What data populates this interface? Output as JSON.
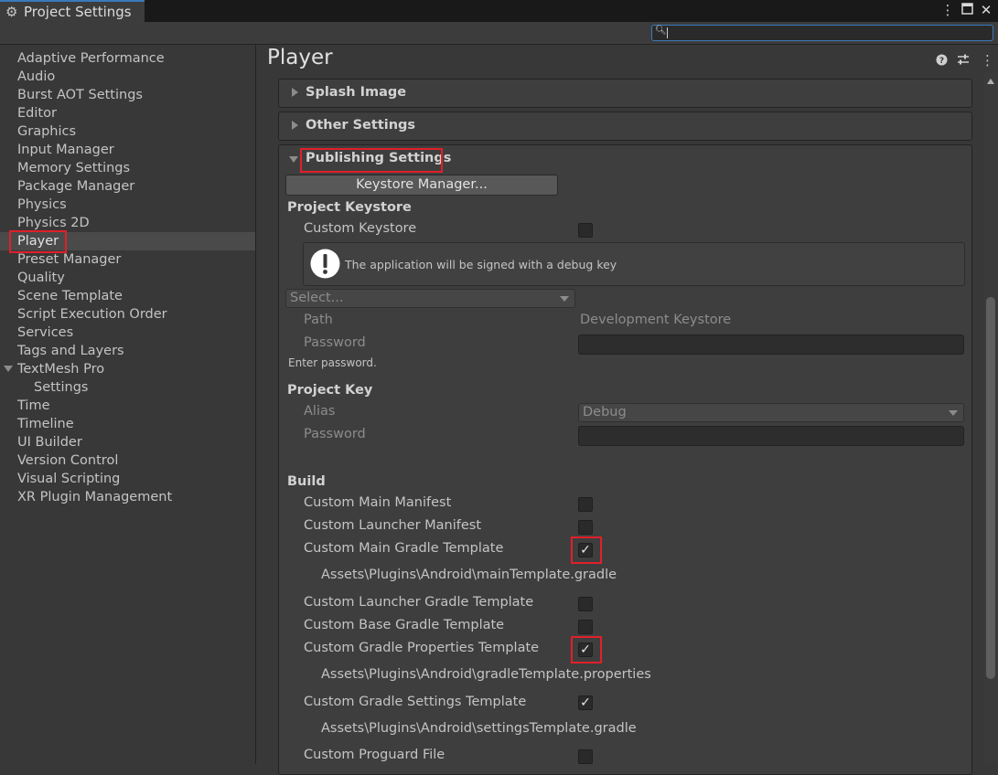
{
  "window": {
    "tab_title": "Project Settings",
    "menu_icon": "kebab-menu-icon",
    "maximize_icon": "maximize-icon",
    "close_icon": "close-icon"
  },
  "search": {
    "value": "",
    "placeholder": ""
  },
  "sidebar": {
    "items": [
      {
        "label": "Adaptive Performance"
      },
      {
        "label": "Audio"
      },
      {
        "label": "Burst AOT Settings"
      },
      {
        "label": "Editor"
      },
      {
        "label": "Graphics"
      },
      {
        "label": "Input Manager"
      },
      {
        "label": "Memory Settings"
      },
      {
        "label": "Package Manager"
      },
      {
        "label": "Physics"
      },
      {
        "label": "Physics 2D"
      },
      {
        "label": "Player"
      },
      {
        "label": "Preset Manager"
      },
      {
        "label": "Quality"
      },
      {
        "label": "Scene Template"
      },
      {
        "label": "Script Execution Order"
      },
      {
        "label": "Services"
      },
      {
        "label": "Tags and Layers"
      },
      {
        "label": "TextMesh Pro"
      },
      {
        "label": "Settings"
      },
      {
        "label": "Time"
      },
      {
        "label": "Timeline"
      },
      {
        "label": "UI Builder"
      },
      {
        "label": "Version Control"
      },
      {
        "label": "Visual Scripting"
      },
      {
        "label": "XR Plugin Management"
      }
    ],
    "selected": "Player"
  },
  "main": {
    "title": "Player",
    "header_icons": [
      "help-icon",
      "preset-icon",
      "more-icon"
    ],
    "sections": {
      "splash": "Splash Image",
      "other": "Other Settings",
      "publishing": "Publishing Settings"
    },
    "keystore_manager_button": "Keystore Manager...",
    "project_keystore": {
      "heading": "Project Keystore",
      "custom_keystore_label": "Custom Keystore",
      "custom_keystore_checked": false,
      "info_message": "The application will be signed with a debug key",
      "select_value": "Select...",
      "path_label": "Path",
      "path_value": "Development Keystore",
      "password_label": "Password",
      "password_hint": "Enter password."
    },
    "project_key": {
      "heading": "Project Key",
      "alias_label": "Alias",
      "alias_value": "Debug",
      "password_label": "Password"
    },
    "build": {
      "heading": "Build",
      "items": [
        {
          "label": "Custom Main Manifest",
          "checked": false
        },
        {
          "label": "Custom Launcher Manifest",
          "checked": false
        },
        {
          "label": "Custom Main Gradle Template",
          "checked": true,
          "path": "Assets\\Plugins\\Android\\mainTemplate.gradle"
        },
        {
          "label": "Custom Launcher Gradle Template",
          "checked": false
        },
        {
          "label": "Custom Base Gradle Template",
          "checked": false
        },
        {
          "label": "Custom Gradle Properties Template",
          "checked": true,
          "path": "Assets\\Plugins\\Android\\gradleTemplate.properties"
        },
        {
          "label": "Custom Gradle Settings Template",
          "checked": true,
          "path": "Assets\\Plugins\\Android\\settingsTemplate.gradle"
        },
        {
          "label": "Custom Proguard File",
          "checked": false
        }
      ]
    }
  },
  "colors": {
    "highlight": "#e0202a",
    "accent": "#3a79bb"
  }
}
